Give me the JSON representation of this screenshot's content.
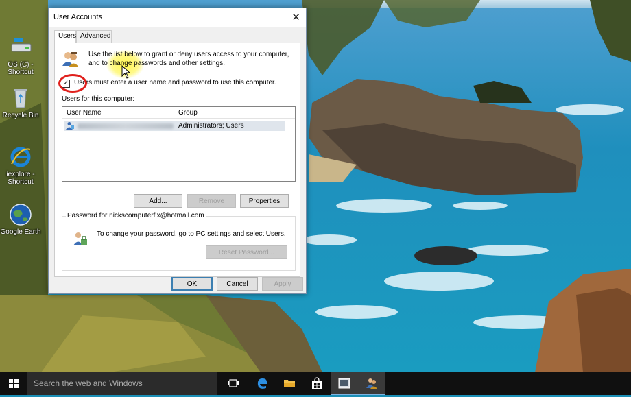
{
  "desktop": {
    "icons": [
      {
        "label_line1": "OS (C) -",
        "label_line2": "Shortcut",
        "icon": "drive-icon"
      },
      {
        "label_line1": "Recycle Bin",
        "label_line2": "",
        "icon": "recycle-bin-icon"
      },
      {
        "label_line1": "iexplore -",
        "label_line2": "Shortcut",
        "icon": "internet-explorer-icon"
      },
      {
        "label_line1": "Google Earth",
        "label_line2": "",
        "icon": "google-earth-icon"
      }
    ]
  },
  "dialog": {
    "title": "User Accounts",
    "close_glyph": "✕",
    "tabs": [
      {
        "label": "Users",
        "active": true
      },
      {
        "label": "Advanced",
        "active": false
      }
    ],
    "intro_text": "Use the list below to grant or deny users access to your computer, and to change passwords and other settings.",
    "checkbox_checked": true,
    "checkbox_glyph": "✓",
    "checkbox_label": "Users must enter a user name and password to use this computer.",
    "users_label": "Users for this computer:",
    "table": {
      "columns": [
        "User Name",
        "Group"
      ],
      "rows": [
        {
          "group": "Administrators; Users",
          "selected": true
        }
      ]
    },
    "buttons": {
      "add": "Add...",
      "remove": "Remove",
      "properties": "Properties"
    },
    "password_group": {
      "legend": "Password for nickscomputerfix@hotmail.com",
      "text": "To change your password, go to PC settings and select Users.",
      "reset_button": "Reset Password..."
    },
    "footer": {
      "ok": "OK",
      "cancel": "Cancel",
      "apply": "Apply"
    }
  },
  "taskbar": {
    "search_placeholder": "Search the web and Windows",
    "items": [
      "task-view-icon",
      "edge-icon",
      "file-explorer-icon",
      "store-icon",
      "screen-recorder-icon",
      "user-accounts-icon"
    ]
  },
  "colors": {
    "accent": "#3c7fb1",
    "annotation_circle": "#e0201c",
    "highlight": "#fff53c"
  }
}
